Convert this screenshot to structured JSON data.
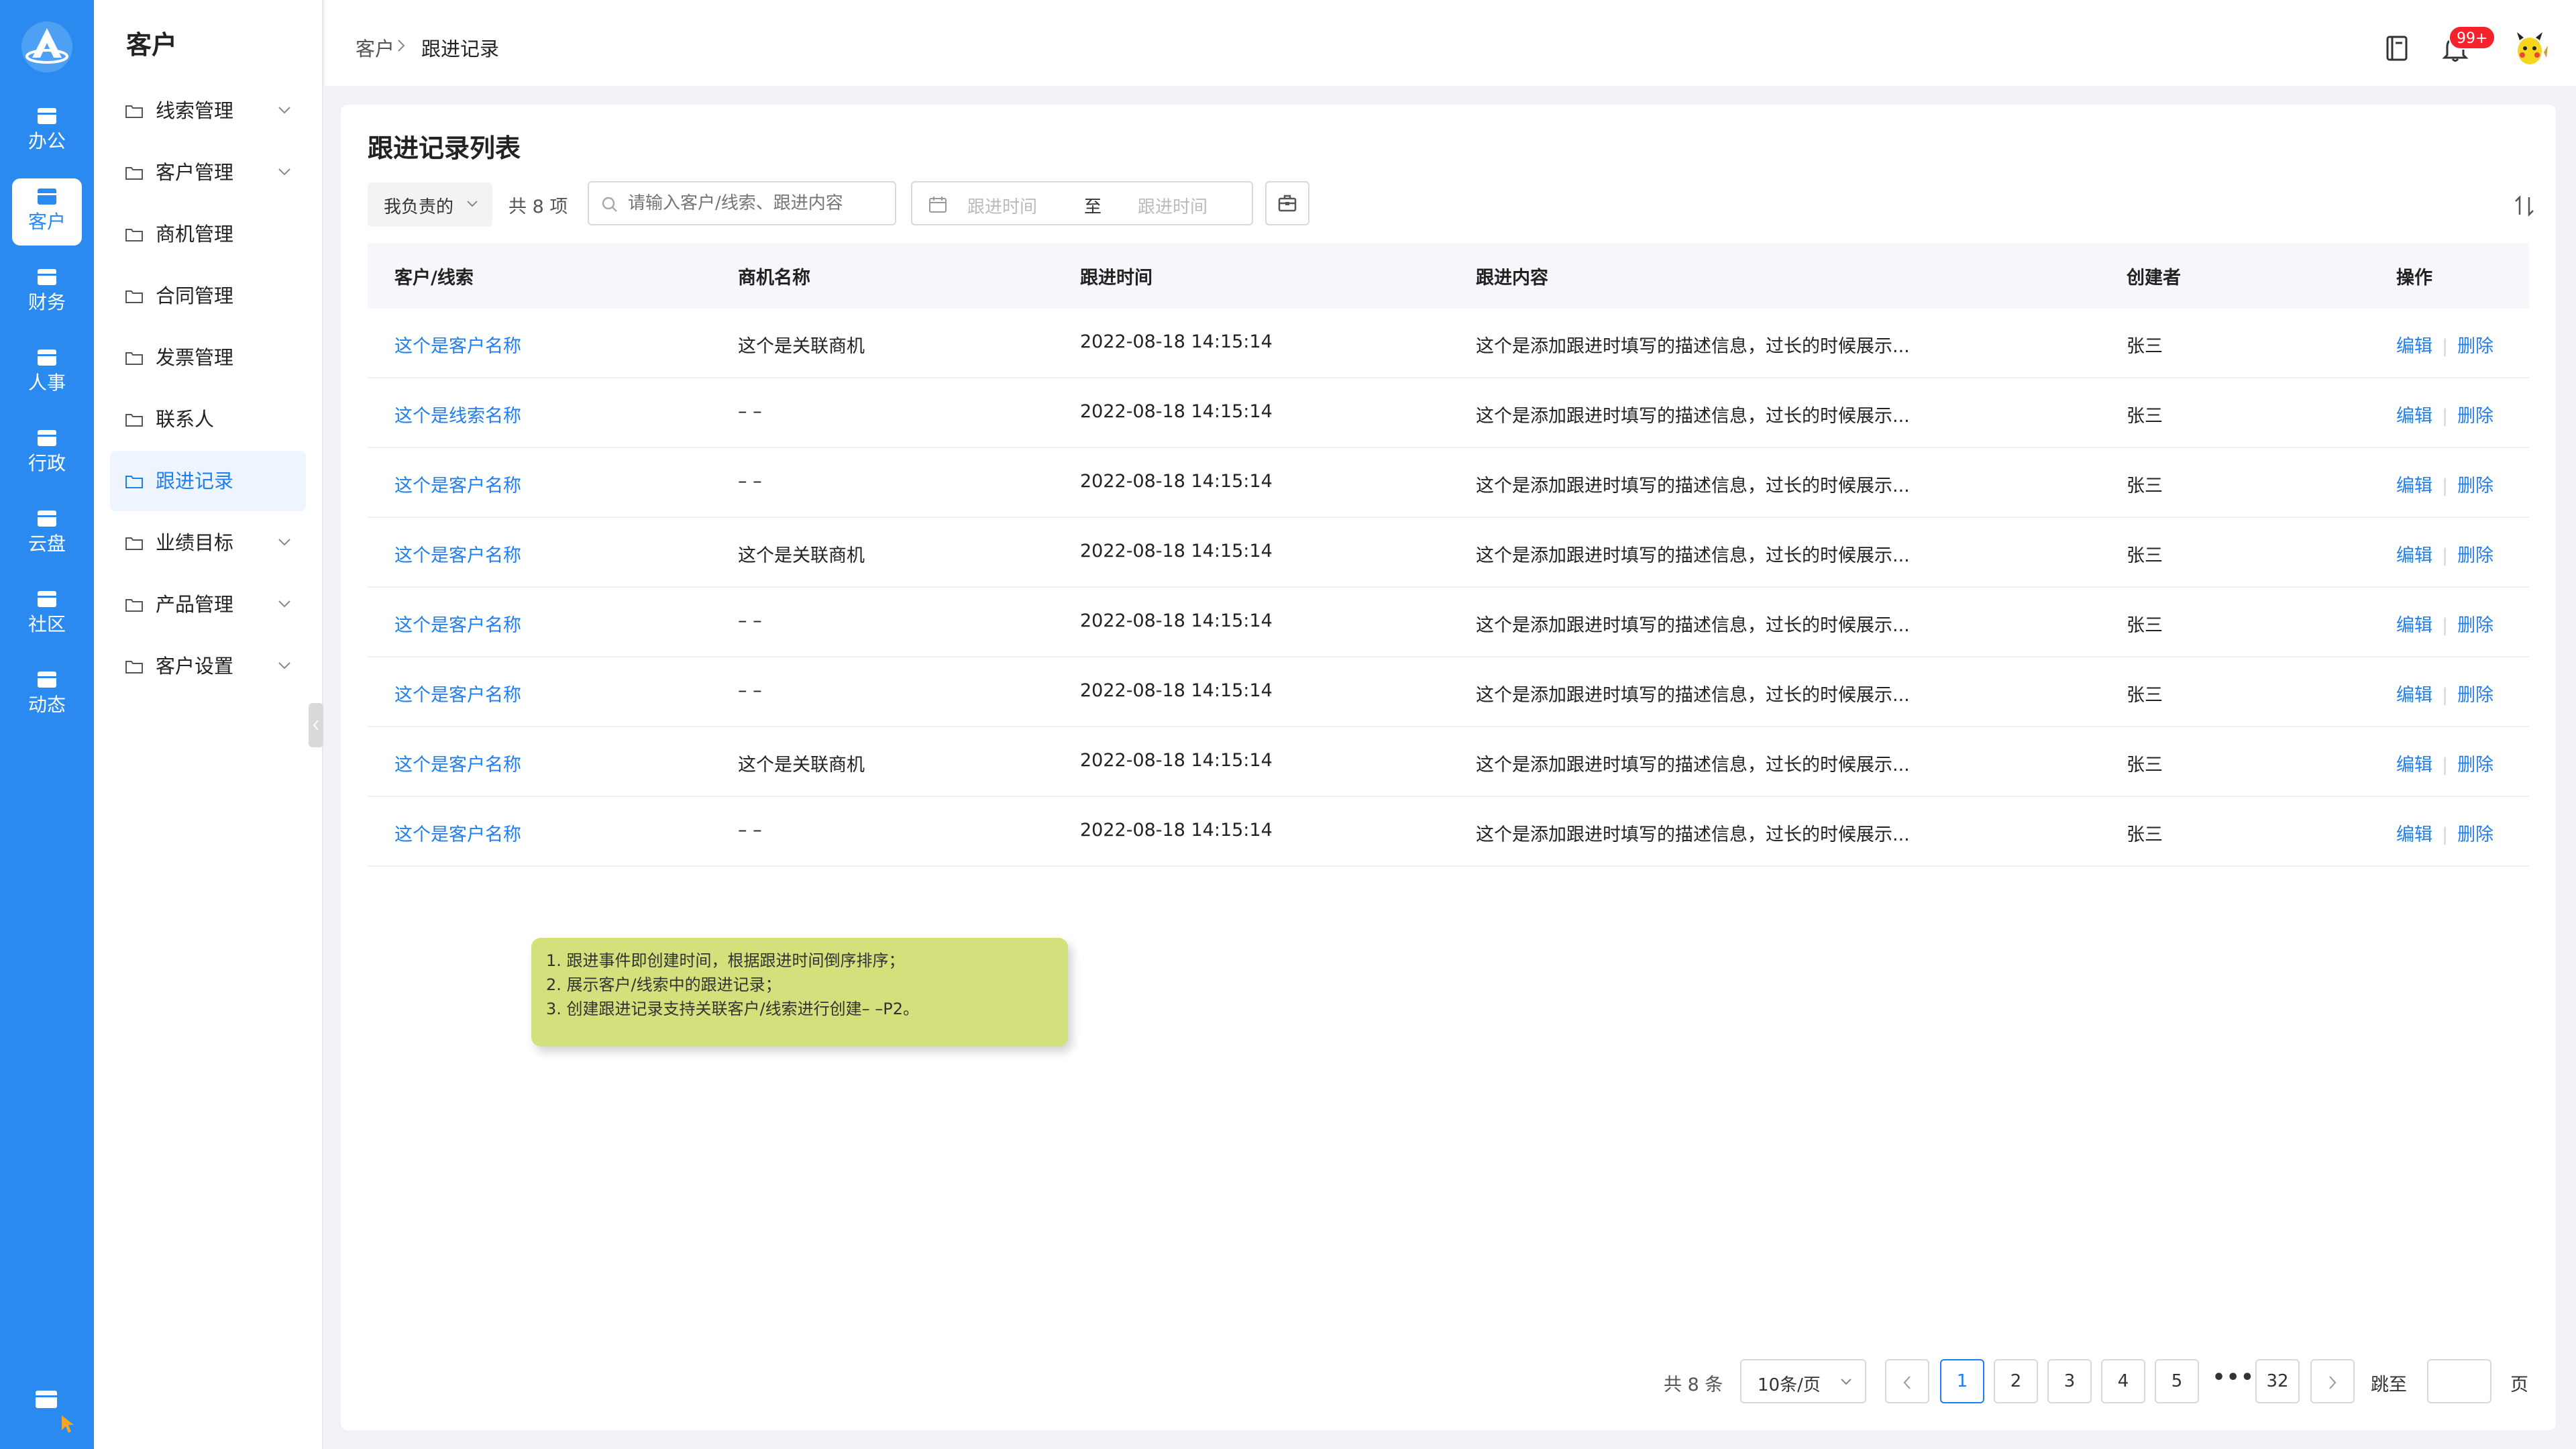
{
  "rail": {
    "items": [
      {
        "label": "办公",
        "active": false
      },
      {
        "label": "客户",
        "active": true
      },
      {
        "label": "财务",
        "active": false
      },
      {
        "label": "人事",
        "active": false
      },
      {
        "label": "行政",
        "active": false
      },
      {
        "label": "云盘",
        "active": false
      },
      {
        "label": "社区",
        "active": false
      },
      {
        "label": "动态",
        "active": false
      }
    ]
  },
  "subnav": {
    "title": "客户",
    "items": [
      {
        "label": "线索管理",
        "expandable": true,
        "active": false
      },
      {
        "label": "客户管理",
        "expandable": true,
        "active": false
      },
      {
        "label": "商机管理",
        "expandable": false,
        "active": false
      },
      {
        "label": "合同管理",
        "expandable": false,
        "active": false
      },
      {
        "label": "发票管理",
        "expandable": false,
        "active": false
      },
      {
        "label": "联系人",
        "expandable": false,
        "active": false
      },
      {
        "label": "跟进记录",
        "expandable": false,
        "active": true
      },
      {
        "label": "业绩目标",
        "expandable": true,
        "active": false
      },
      {
        "label": "产品管理",
        "expandable": true,
        "active": false
      },
      {
        "label": "客户设置",
        "expandable": true,
        "active": false
      }
    ]
  },
  "breadcrumb": {
    "parent": "客户",
    "current": "跟进记录"
  },
  "header": {
    "notification_badge": "99+"
  },
  "main": {
    "title": "跟进记录列表",
    "filter_scope": "我负责的",
    "count_text": "共 8 项",
    "search_placeholder": "请输入客户/线索、跟进内容",
    "date_start_placeholder": "跟进时间",
    "date_to": "至",
    "date_end_placeholder": "跟进时间"
  },
  "table": {
    "columns": [
      "客户/线索",
      "商机名称",
      "跟进时间",
      "跟进内容",
      "创建者",
      "操作"
    ],
    "edit_label": "编辑",
    "delete_label": "删除",
    "rows": [
      {
        "customer": "这个是客户名称",
        "opportunity": "这个是关联商机",
        "time": "2022-08-18 14:15:14",
        "content": "这个是添加跟进时填写的描述信息，过长的时候展示...",
        "creator": "张三"
      },
      {
        "customer": "这个是线索名称",
        "opportunity": "– –",
        "time": "2022-08-18 14:15:14",
        "content": "这个是添加跟进时填写的描述信息，过长的时候展示...",
        "creator": "张三"
      },
      {
        "customer": "这个是客户名称",
        "opportunity": "– –",
        "time": "2022-08-18 14:15:14",
        "content": "这个是添加跟进时填写的描述信息，过长的时候展示...",
        "creator": "张三"
      },
      {
        "customer": "这个是客户名称",
        "opportunity": "这个是关联商机",
        "time": "2022-08-18 14:15:14",
        "content": "这个是添加跟进时填写的描述信息，过长的时候展示...",
        "creator": "张三"
      },
      {
        "customer": "这个是客户名称",
        "opportunity": "– –",
        "time": "2022-08-18 14:15:14",
        "content": "这个是添加跟进时填写的描述信息，过长的时候展示...",
        "creator": "张三"
      },
      {
        "customer": "这个是客户名称",
        "opportunity": "– –",
        "time": "2022-08-18 14:15:14",
        "content": "这个是添加跟进时填写的描述信息，过长的时候展示...",
        "creator": "张三"
      },
      {
        "customer": "这个是客户名称",
        "opportunity": "这个是关联商机",
        "time": "2022-08-18 14:15:14",
        "content": "这个是添加跟进时填写的描述信息，过长的时候展示...",
        "creator": "张三"
      },
      {
        "customer": "这个是客户名称",
        "opportunity": "– –",
        "time": "2022-08-18 14:15:14",
        "content": "这个是添加跟进时填写的描述信息，过长的时候展示...",
        "creator": "张三"
      }
    ]
  },
  "note": {
    "lines": [
      "1. 跟进事件即创建时间，根据跟进时间倒序排序；",
      "2. 展示客户/线索中的跟进记录；",
      "3. 创建跟进记录支持关联客户/线索进行创建– –P2。"
    ]
  },
  "pagination": {
    "total_text": "共 8 条",
    "page_size": "10条/页",
    "pages": [
      "1",
      "2",
      "3",
      "4",
      "5"
    ],
    "current_page": "1",
    "ellipsis": "•••",
    "last_page": "32",
    "jump_label": "跳至",
    "page_suffix": "页"
  },
  "colors": {
    "rail": "#2b8af0",
    "accent": "#1f7ef0",
    "note": "#d3e07c",
    "badge": "#f5222d"
  },
  "icons": [
    "app-logo-icon",
    "folder-icon",
    "chevron-down-icon",
    "chevron-right-icon",
    "book-icon",
    "bell-icon",
    "avatar",
    "search-icon",
    "calendar-icon",
    "export-icon",
    "sort-icon"
  ]
}
